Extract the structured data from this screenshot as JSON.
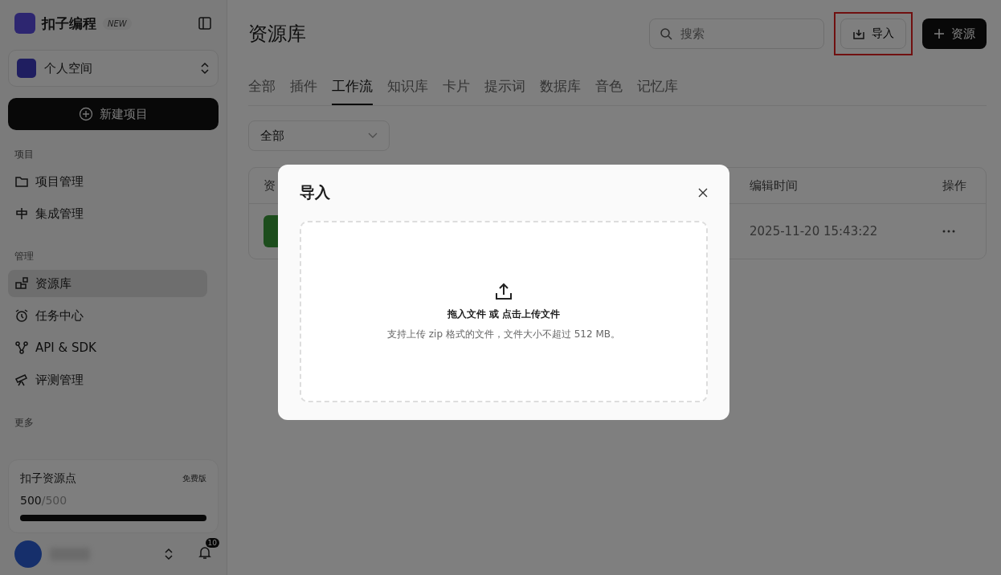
{
  "app": {
    "name": "扣子编程",
    "badge": "NEW"
  },
  "workspace": {
    "label": "个人空间"
  },
  "new_project_button": {
    "label": "新建项目"
  },
  "sidebar": {
    "sections": [
      {
        "heading": "项目",
        "items": [
          {
            "label": "项目管理",
            "selected": false
          },
          {
            "label": "集成管理",
            "selected": false
          }
        ]
      },
      {
        "heading": "管理",
        "items": [
          {
            "label": "资源库",
            "selected": true
          },
          {
            "label": "任务中心",
            "selected": false
          },
          {
            "label": "API & SDK",
            "selected": false
          },
          {
            "label": "评测管理",
            "selected": false
          }
        ]
      }
    ],
    "more_heading": "更多"
  },
  "credits": {
    "title": "扣子资源点",
    "plan": "免费版",
    "used": "500",
    "total": "/500",
    "level": 1
  },
  "notifications": {
    "count": "10"
  },
  "page": {
    "title": "资源库"
  },
  "search": {
    "placeholder": "搜索"
  },
  "import_button": {
    "label": "导入",
    "highlighted": true
  },
  "add_button": {
    "label": "资源"
  },
  "tabs": [
    {
      "label": "全部",
      "selected": false
    },
    {
      "label": "插件",
      "selected": false
    },
    {
      "label": "工作流",
      "selected": true
    },
    {
      "label": "知识库",
      "selected": false
    },
    {
      "label": "卡片",
      "selected": false
    },
    {
      "label": "提示词",
      "selected": false
    },
    {
      "label": "数据库",
      "selected": false
    },
    {
      "label": "音色",
      "selected": false
    },
    {
      "label": "记忆库",
      "selected": false
    }
  ],
  "filter": {
    "value": "全部"
  },
  "table": {
    "columns": [
      "资",
      "编辑时间",
      "操作"
    ],
    "rows": [
      {
        "edited": "2025-11-20 15:43:22"
      }
    ]
  },
  "dialog": {
    "title": "导入",
    "prompt": "拖入文件 或 点击上传文件",
    "hint": "支持上传 zip 格式的文件，文件大小不超过 512 MB。"
  }
}
